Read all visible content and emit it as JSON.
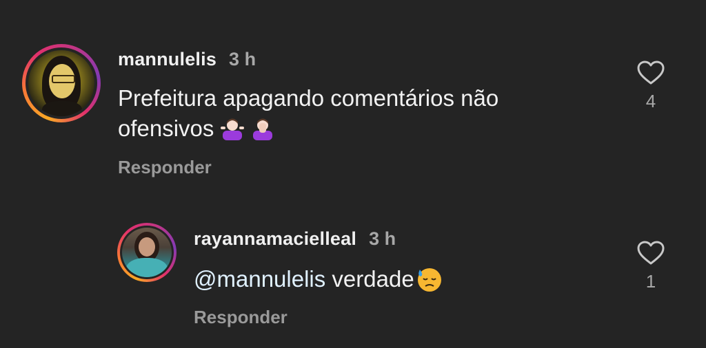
{
  "comments": [
    {
      "username": "mannulelis",
      "time": "3 h",
      "text_line1": "Prefeitura apagando comentários não",
      "text_line2": "ofensivos",
      "emojis": [
        "person-shrugging-emoji",
        "person-facepalming-emoji"
      ],
      "reply_label": "Responder",
      "like_count": "4"
    },
    {
      "username": "rayannamacielleal",
      "time": "3 h",
      "mention": "@mannulelis",
      "text": " verdade",
      "emojis": [
        "downcast-face-with-sweat-emoji"
      ],
      "reply_label": "Responder",
      "like_count": "1"
    }
  ],
  "colors": {
    "background": "#242424",
    "story_ring": [
      "#f9a825",
      "#e1306c",
      "#833ab4"
    ],
    "mention": "#e0f1ff",
    "secondary_text": "#a8a8a8"
  }
}
